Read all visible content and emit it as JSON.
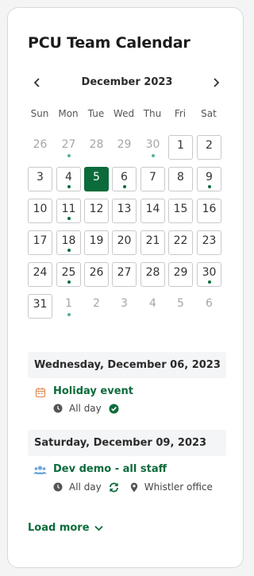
{
  "calendar": {
    "title": "PCU Team Calendar",
    "month_label": "December 2023",
    "weekdays": [
      "Sun",
      "Mon",
      "Tue",
      "Wed",
      "Thu",
      "Fri",
      "Sat"
    ],
    "weeks": [
      [
        {
          "d": "26",
          "out": true
        },
        {
          "d": "27",
          "out": true,
          "dot": true
        },
        {
          "d": "28",
          "out": true
        },
        {
          "d": "29",
          "out": true
        },
        {
          "d": "30",
          "out": true,
          "dot": true
        },
        {
          "d": "1"
        },
        {
          "d": "2"
        }
      ],
      [
        {
          "d": "3"
        },
        {
          "d": "4",
          "dot": true
        },
        {
          "d": "5",
          "sel": true
        },
        {
          "d": "6",
          "dot": true
        },
        {
          "d": "7"
        },
        {
          "d": "8"
        },
        {
          "d": "9",
          "dot": true
        }
      ],
      [
        {
          "d": "10"
        },
        {
          "d": "11",
          "dot": true
        },
        {
          "d": "12"
        },
        {
          "d": "13"
        },
        {
          "d": "14"
        },
        {
          "d": "15"
        },
        {
          "d": "16"
        }
      ],
      [
        {
          "d": "17"
        },
        {
          "d": "18",
          "dot": true
        },
        {
          "d": "19"
        },
        {
          "d": "20"
        },
        {
          "d": "21"
        },
        {
          "d": "22"
        },
        {
          "d": "23"
        }
      ],
      [
        {
          "d": "24"
        },
        {
          "d": "25",
          "dot": true
        },
        {
          "d": "26"
        },
        {
          "d": "27"
        },
        {
          "d": "28"
        },
        {
          "d": "29"
        },
        {
          "d": "30",
          "dot": true
        }
      ],
      [
        {
          "d": "31"
        },
        {
          "d": "1",
          "out": true,
          "dot": true
        },
        {
          "d": "2",
          "out": true
        },
        {
          "d": "3",
          "out": true
        },
        {
          "d": "4",
          "out": true
        },
        {
          "d": "5",
          "out": true
        },
        {
          "d": "6",
          "out": true
        }
      ]
    ]
  },
  "agenda": [
    {
      "date_label": "Wednesday, December 06, 2023",
      "event": {
        "title": "Holiday event",
        "icon": "calendar-icon",
        "time": "All day",
        "status_icon": "check-circle-icon"
      }
    },
    {
      "date_label": "Saturday, December 09, 2023",
      "event": {
        "title": "Dev demo - all staff",
        "icon": "users-icon",
        "time": "All day",
        "recurring_icon": "refresh-icon",
        "location": "Whistler office"
      }
    }
  ],
  "load_more_label": "Load more",
  "colors": {
    "accent": "#0c6b3b",
    "section_bg": "#f4f5f7"
  }
}
